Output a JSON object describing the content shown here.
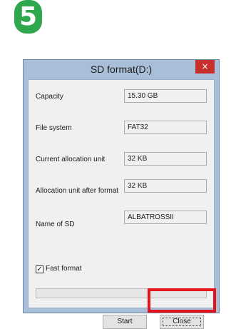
{
  "step": {
    "number": "5"
  },
  "dialog": {
    "title": "SD format(D:)",
    "close_glyph": "×",
    "fields": [
      {
        "label": "Capacity",
        "value": "15.30 GB"
      },
      {
        "label": "File system",
        "value": "FAT32"
      },
      {
        "label": "Current allocation unit",
        "value": "32 KB"
      },
      {
        "label": "Allocation unit after format",
        "value": "32 KB"
      },
      {
        "label": "Name of SD",
        "value": "ALBATROSSII"
      }
    ],
    "fast_format": {
      "label": "Fast format",
      "checked": true,
      "check_glyph": "✓"
    },
    "progress": {
      "fraction": 0
    },
    "buttons": {
      "start": "Start",
      "close": "Close"
    }
  },
  "colors": {
    "badge": "#2fa74c",
    "title_close": "#c7302a",
    "highlight": "#e5141b"
  },
  "icons": {
    "step_badge": "number-badge-icon",
    "window_close": "close-icon",
    "checkbox": "checkmark-icon"
  }
}
